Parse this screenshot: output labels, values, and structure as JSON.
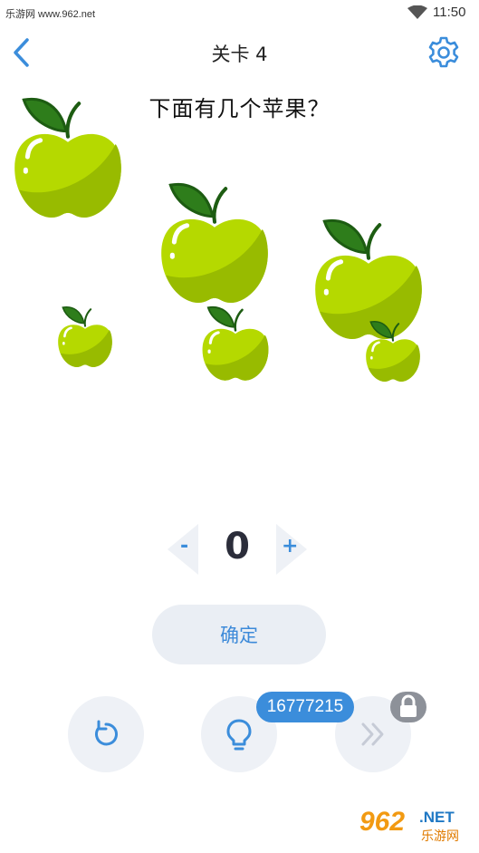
{
  "status_bar": {
    "watermark": "乐游网 www.962.net",
    "time": "11:50"
  },
  "header": {
    "title": "关卡 4"
  },
  "question": "下面有几个苹果？",
  "counter": {
    "minus_label": "-",
    "value": "0",
    "plus_label": "+"
  },
  "confirm_label": "确定",
  "hint_count": "16777215",
  "watermark_logo": {
    "brand": "962",
    "suffix": ".NET",
    "site": "乐游网"
  },
  "colors": {
    "accent": "#3b8ddb",
    "apple_light": "#b5d900",
    "apple_dark": "#98bb00",
    "leaf": "#2e7d1b",
    "stem": "#1d5c12"
  },
  "icons": [
    "back-arrow-icon",
    "gear-icon",
    "restart-icon",
    "lightbulb-icon",
    "skip-icon",
    "lock-icon"
  ]
}
